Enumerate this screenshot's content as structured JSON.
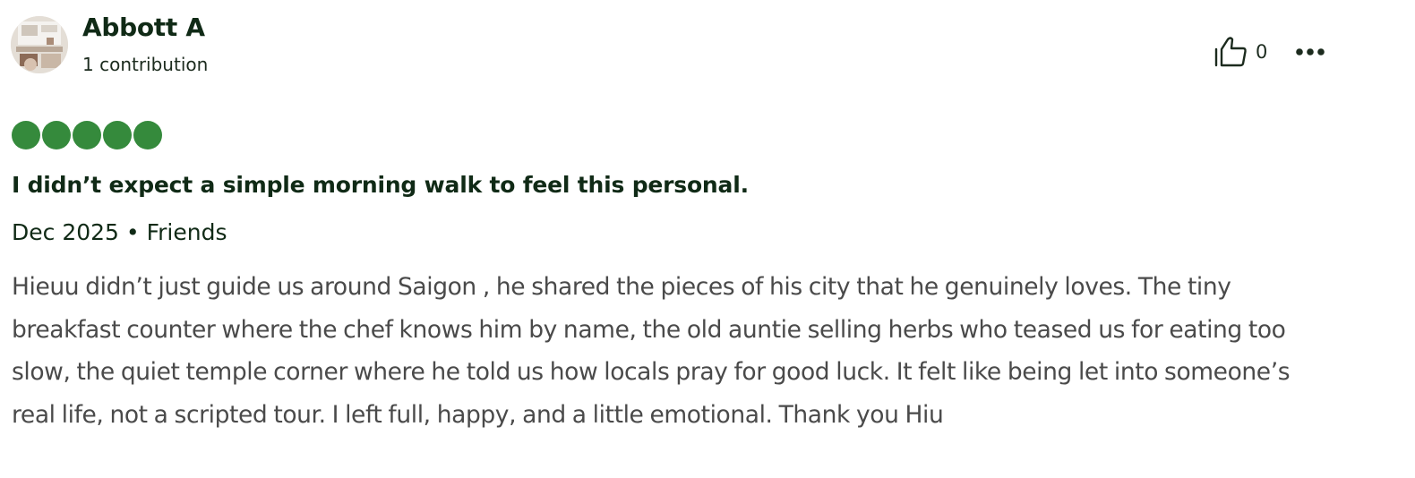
{
  "review": {
    "author": {
      "name": "Abbott A",
      "contributions": "1 contribution",
      "avatar_icon": "user-photo-avatar"
    },
    "actions": {
      "like_icon": "thumbs-up-icon",
      "like_count": "0",
      "more_icon": "more-horizontal-icon"
    },
    "rating": {
      "value": 5,
      "max": 5,
      "color": "#358a3c"
    },
    "title": "I didn’t expect a simple morning walk to feel this personal.",
    "meta": "Dec 2025 • Friends",
    "text": "Hieuu didn’t just guide us around Saigon , he shared the pieces of his city that he genuinely loves. The tiny breakfast counter where the chef knows him by name, the old auntie selling herbs who teased us for eating too slow, the quiet temple corner where he told us how locals pray for good luck. It felt like being let into someone’s real life, not a scripted tour. I left full, happy, and a little emotional. Thank you Hiu"
  }
}
